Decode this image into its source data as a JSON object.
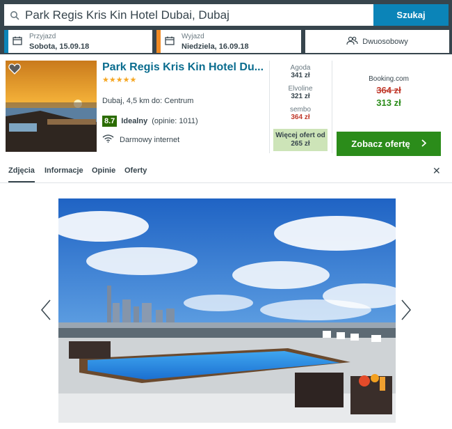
{
  "search": {
    "query": "Park Regis Kris Kin Hotel Dubai, Dubaj",
    "button_label": "Szukaj"
  },
  "dates": {
    "checkin_label": "Przyjazd",
    "checkin_value": "Sobota, 15.09.18",
    "checkout_label": "Wyjazd",
    "checkout_value": "Niedziela, 16.09.18"
  },
  "room": {
    "label": "Dwuosobowy"
  },
  "hotel": {
    "name": "Park Regis Kris Kin Hotel Du...",
    "stars": "★★★★★",
    "location": "Dubaj, 4,5 km do: Centrum",
    "rating_score": "8.7",
    "rating_label": "Idealny",
    "rating_reviews": "(opinie: 1011)",
    "amenity": "Darmowy internet"
  },
  "offers": [
    {
      "provider": "Agoda",
      "price": "341 zł"
    },
    {
      "provider": "Elvoline",
      "price": "321 zł"
    },
    {
      "provider": "sembo",
      "price": "364 zł"
    }
  ],
  "more_offers": {
    "line1": "Więcej ofert od",
    "line2": "265 zł"
  },
  "best_offer": {
    "provider": "Booking.com",
    "old_price": "364 zł",
    "new_price": "313 zł",
    "button_label": "Zobacz ofertę"
  },
  "tabs": [
    "Zdjęcia",
    "Informacje",
    "Opinie",
    "Oferty"
  ],
  "colors": {
    "brand_dark": "#37454d",
    "search_blue": "#0b84b8",
    "deal_green": "#2b8c1a",
    "checkin_accent": "#0b84b8",
    "checkout_accent": "#f08a24"
  },
  "icons": [
    "search-icon",
    "calendar-icon",
    "users-icon",
    "heart-icon",
    "wifi-icon",
    "chevron-right-icon",
    "close-icon",
    "chevron-left-icon"
  ]
}
